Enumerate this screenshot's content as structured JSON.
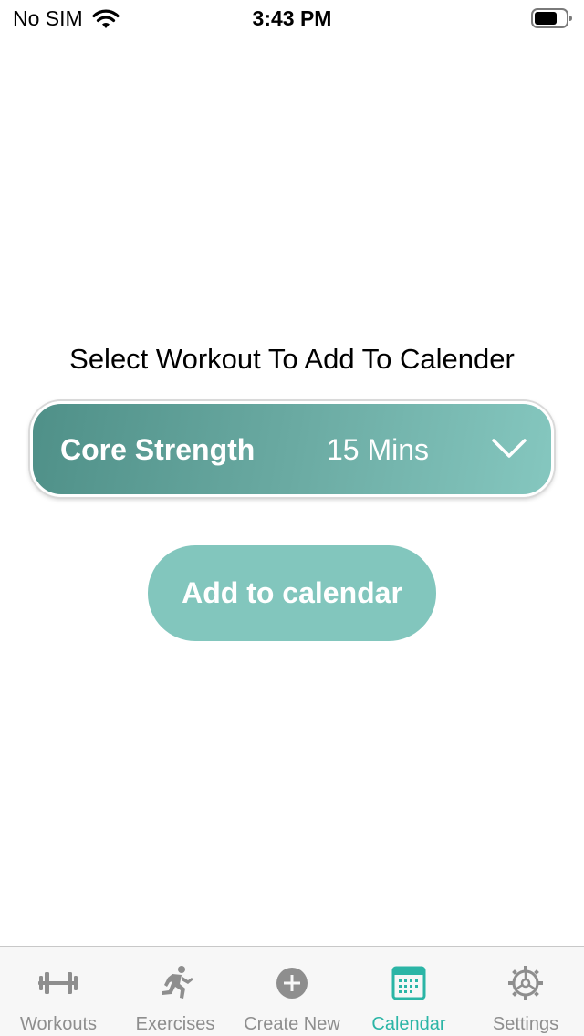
{
  "status_bar": {
    "carrier": "No SIM",
    "time": "3:43 PM"
  },
  "main": {
    "prompt": "Select Workout To Add To Calender",
    "selected_workout": {
      "name": "Core Strength",
      "duration": "15 Mins"
    },
    "add_button_label": "Add to calendar"
  },
  "tab_bar": {
    "tabs": [
      {
        "label": "Workouts",
        "icon": "barbell-icon",
        "active": false
      },
      {
        "label": "Exercises",
        "icon": "runner-icon",
        "active": false
      },
      {
        "label": "Create New",
        "icon": "plus-circle-icon",
        "active": false
      },
      {
        "label": "Calendar",
        "icon": "calendar-icon",
        "active": true
      },
      {
        "label": "Settings",
        "icon": "gear-icon",
        "active": false
      }
    ]
  },
  "colors": {
    "accent": "#2bb5a6",
    "button": "#82c6bd",
    "select_gradient_start": "#4f9088",
    "select_gradient_end": "#85c7bf",
    "inactive_tab": "#8e8e8e"
  }
}
